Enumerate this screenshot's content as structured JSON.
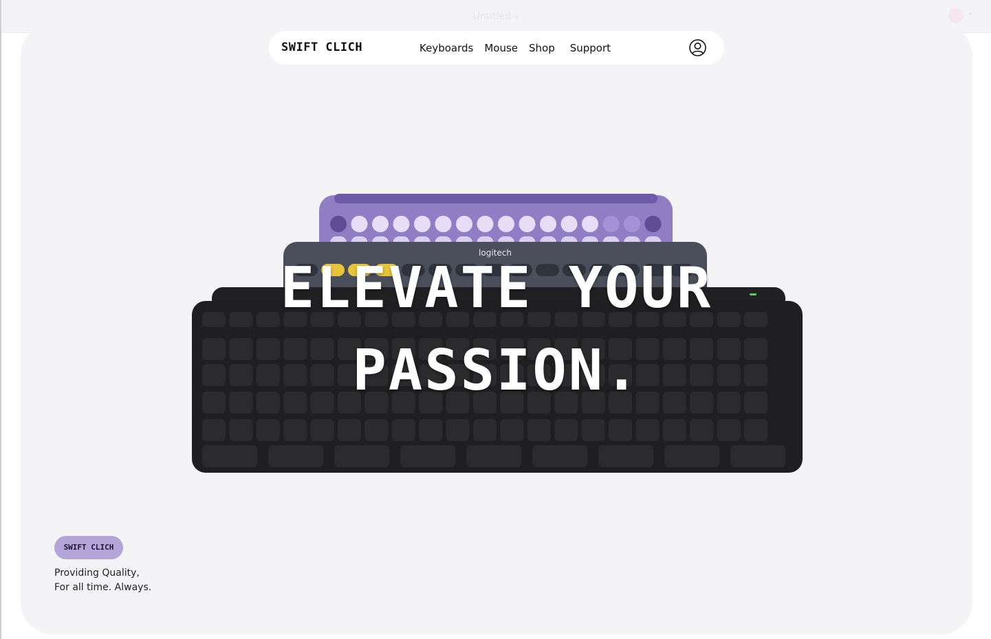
{
  "window": {
    "title": "Untitled",
    "title_menu_icon": "chevron-down-icon"
  },
  "nav": {
    "brand": "SWIFT CLICH",
    "links": [
      "Keyboards",
      "Mouse",
      "Shop",
      "Support"
    ],
    "user_icon": "user-circle-icon"
  },
  "hero": {
    "headline_line1": "ELEVATE YOUR",
    "headline_line2": "PASSION.",
    "keyboard_brand": "logitech",
    "image_description_colors": {
      "purple_keyboard": "#8f7ec4",
      "grey_keyboard": "#4a4f5c",
      "black_keyboard": "#1f1f21",
      "yellow_keys": "#e7c43a"
    }
  },
  "footer": {
    "badge": "SWIFT CLICH",
    "tagline_line1": "Providing Quality,",
    "tagline_line2": "For all time. Always."
  },
  "colors": {
    "page_bg": "#f4f4f6",
    "nav_bg": "#ffffff",
    "badge_bg": "#b3a5d8",
    "text": "#111111"
  }
}
